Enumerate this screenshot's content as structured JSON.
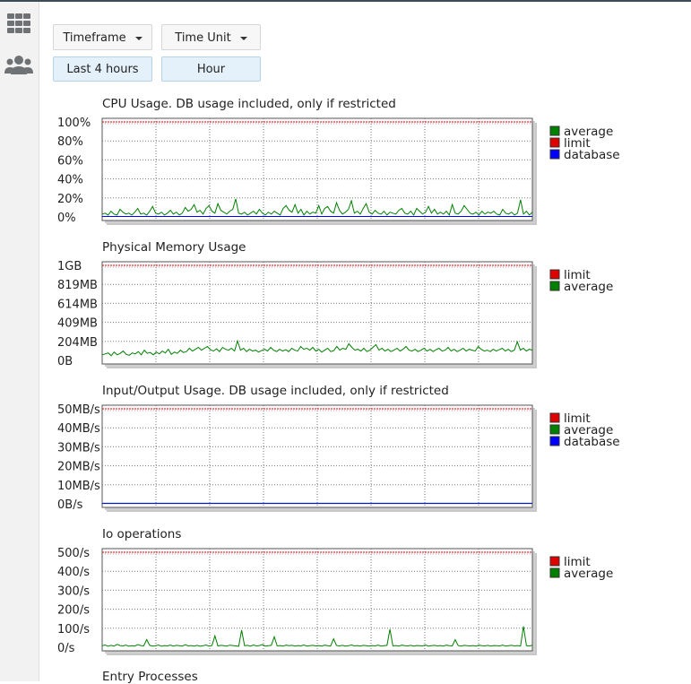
{
  "sidebar": {
    "items": [
      {
        "icon": "grid-icon"
      },
      {
        "icon": "users-icon"
      }
    ]
  },
  "filters": {
    "timeframe_label": "Timeframe",
    "timeframe_value": "Last 4 hours",
    "timeunit_label": "Time Unit",
    "timeunit_value": "Hour"
  },
  "colors": {
    "average": "#008000",
    "limit": "#e00000",
    "database": "#0000ff"
  },
  "chart_data": [
    {
      "type": "line",
      "title": "CPU Usage. DB usage included, only if restricted",
      "yticks": [
        "100%",
        "80%",
        "60%",
        "40%",
        "20%",
        "0%"
      ],
      "ylim": [
        0,
        100
      ],
      "grid": true,
      "legend_position": "right",
      "legend": [
        "average",
        "limit",
        "database"
      ],
      "series": [
        {
          "name": "average",
          "color": "#008000",
          "values": [
            3,
            4,
            2,
            6,
            3,
            2,
            8,
            5,
            3,
            4,
            2,
            5,
            9,
            3,
            4,
            2,
            6,
            11,
            4,
            3,
            5,
            2,
            4,
            7,
            3,
            5,
            2,
            4,
            10,
            6,
            8,
            13,
            5,
            7,
            3,
            9,
            12,
            6,
            4,
            14,
            7,
            5,
            3,
            6,
            8,
            19,
            4,
            3,
            5,
            2,
            4,
            6,
            3,
            8,
            4,
            2,
            5,
            3,
            6,
            4,
            2,
            9,
            12,
            7,
            5,
            13,
            4,
            8,
            2,
            6,
            3,
            5,
            4,
            12,
            3,
            9,
            11,
            6,
            4,
            15,
            7,
            3,
            5,
            8,
            17,
            4,
            6,
            3,
            9,
            14,
            5,
            3,
            7,
            4,
            3,
            6,
            2,
            5,
            4,
            3,
            7,
            9,
            4,
            3,
            6,
            2,
            9,
            6,
            3,
            5,
            11,
            4,
            8,
            3,
            5,
            3,
            6,
            2,
            13,
            4,
            3,
            6,
            12,
            8,
            4,
            3,
            5,
            2,
            6,
            3,
            5,
            4,
            6,
            3,
            2,
            8,
            4,
            3,
            5,
            2,
            4,
            18,
            3,
            6,
            2,
            5
          ]
        },
        {
          "name": "limit",
          "color": "#e00000",
          "values": [
            100,
            100
          ]
        },
        {
          "name": "database",
          "color": "#0000ff",
          "values": [
            0.5,
            0.5
          ]
        }
      ]
    },
    {
      "type": "line",
      "title": "Physical Memory Usage",
      "yticks": [
        "1GB",
        "819MB",
        "614MB",
        "409MB",
        "204MB",
        "0B"
      ],
      "ylim": [
        0,
        1024
      ],
      "grid": true,
      "legend_position": "right",
      "legend": [
        "limit",
        "average"
      ],
      "series": [
        {
          "name": "limit",
          "color": "#e00000",
          "values": [
            1024,
            1024
          ]
        },
        {
          "name": "average",
          "color": "#008000",
          "values": [
            60,
            70,
            80,
            50,
            90,
            60,
            75,
            100,
            65,
            55,
            80,
            70,
            95,
            60,
            110,
            75,
            85,
            60,
            90,
            70,
            100,
            80,
            120,
            65,
            90,
            75,
            110,
            85,
            95,
            130,
            100,
            120,
            140,
            110,
            130,
            150,
            115,
            100,
            125,
            95,
            140,
            120,
            110,
            130,
            100,
            210,
            110,
            130,
            95,
            120,
            100,
            110,
            90,
            105,
            120,
            100,
            140,
            110,
            95,
            120,
            100,
            115,
            95,
            130,
            110,
            100,
            150,
            120,
            130,
            110,
            140,
            100,
            120,
            90,
            110,
            130,
            95,
            105,
            150,
            110,
            130,
            120,
            180,
            140,
            110,
            120,
            100,
            130,
            95,
            110,
            140,
            170,
            110,
            130,
            100,
            120,
            95,
            110,
            130,
            100,
            120,
            150,
            110,
            100,
            120,
            95,
            110,
            130,
            100,
            120,
            95,
            115,
            130,
            100,
            110,
            140,
            100,
            120,
            95,
            110,
            130,
            100,
            120,
            110,
            100,
            150,
            120,
            100,
            110,
            95,
            120,
            100,
            115,
            130,
            100,
            120,
            95,
            110,
            200,
            110,
            130,
            100,
            120,
            110
          ]
        }
      ]
    },
    {
      "type": "line",
      "title": "Input/Output Usage. DB usage included, only if restricted",
      "yticks": [
        "50MB/s",
        "40MB/s",
        "30MB/s",
        "20MB/s",
        "10MB/s",
        "0B/s"
      ],
      "ylim": [
        0,
        50
      ],
      "grid": true,
      "legend_position": "right",
      "legend": [
        "limit",
        "average",
        "database"
      ],
      "series": [
        {
          "name": "limit",
          "color": "#e00000",
          "values": [
            50,
            50
          ]
        },
        {
          "name": "average",
          "color": "#008000",
          "values": [
            0.3,
            0.3
          ]
        },
        {
          "name": "database",
          "color": "#0000ff",
          "values": [
            0.2,
            0.2
          ]
        }
      ]
    },
    {
      "type": "line",
      "title": "Io operations",
      "yticks": [
        "500/s",
        "400/s",
        "300/s",
        "200/s",
        "100/s",
        "0/s"
      ],
      "ylim": [
        0,
        500
      ],
      "grid": true,
      "legend_position": "right",
      "legend": [
        "limit",
        "average"
      ],
      "series": [
        {
          "name": "limit",
          "color": "#e00000",
          "values": [
            500,
            500
          ]
        },
        {
          "name": "average",
          "color": "#008000",
          "values": [
            8,
            12,
            5,
            10,
            6,
            15,
            9,
            7,
            11,
            5,
            8,
            6,
            14,
            9,
            7,
            40,
            10,
            6,
            8,
            12,
            5,
            9,
            7,
            11,
            6,
            10,
            8,
            6,
            13,
            7,
            9,
            6,
            10,
            5,
            8,
            12,
            6,
            9,
            60,
            7,
            10,
            8,
            6,
            11,
            9,
            7,
            5,
            90,
            8,
            10,
            6,
            12,
            7,
            9,
            14,
            6,
            8,
            10,
            55,
            7,
            9,
            6,
            11,
            8,
            10,
            6,
            9,
            7,
            12,
            6,
            8,
            10,
            7,
            9,
            6,
            11,
            8,
            6,
            45,
            9,
            7,
            10,
            6,
            8,
            12,
            7,
            9,
            6,
            10,
            8,
            6,
            9,
            7,
            11,
            6,
            8,
            10,
            95,
            7,
            9,
            6,
            11,
            8,
            7,
            10,
            6,
            9,
            8,
            7,
            12,
            6,
            8,
            10,
            7,
            9,
            6,
            11,
            8,
            7,
            40,
            9,
            6,
            10,
            8,
            7,
            9,
            6,
            11,
            8,
            7,
            10,
            6,
            9,
            8,
            7,
            11,
            6,
            8,
            10,
            7,
            9,
            6,
            110,
            8,
            7,
            10
          ]
        }
      ]
    },
    {
      "type": "line",
      "title": "Entry Processes"
    }
  ]
}
